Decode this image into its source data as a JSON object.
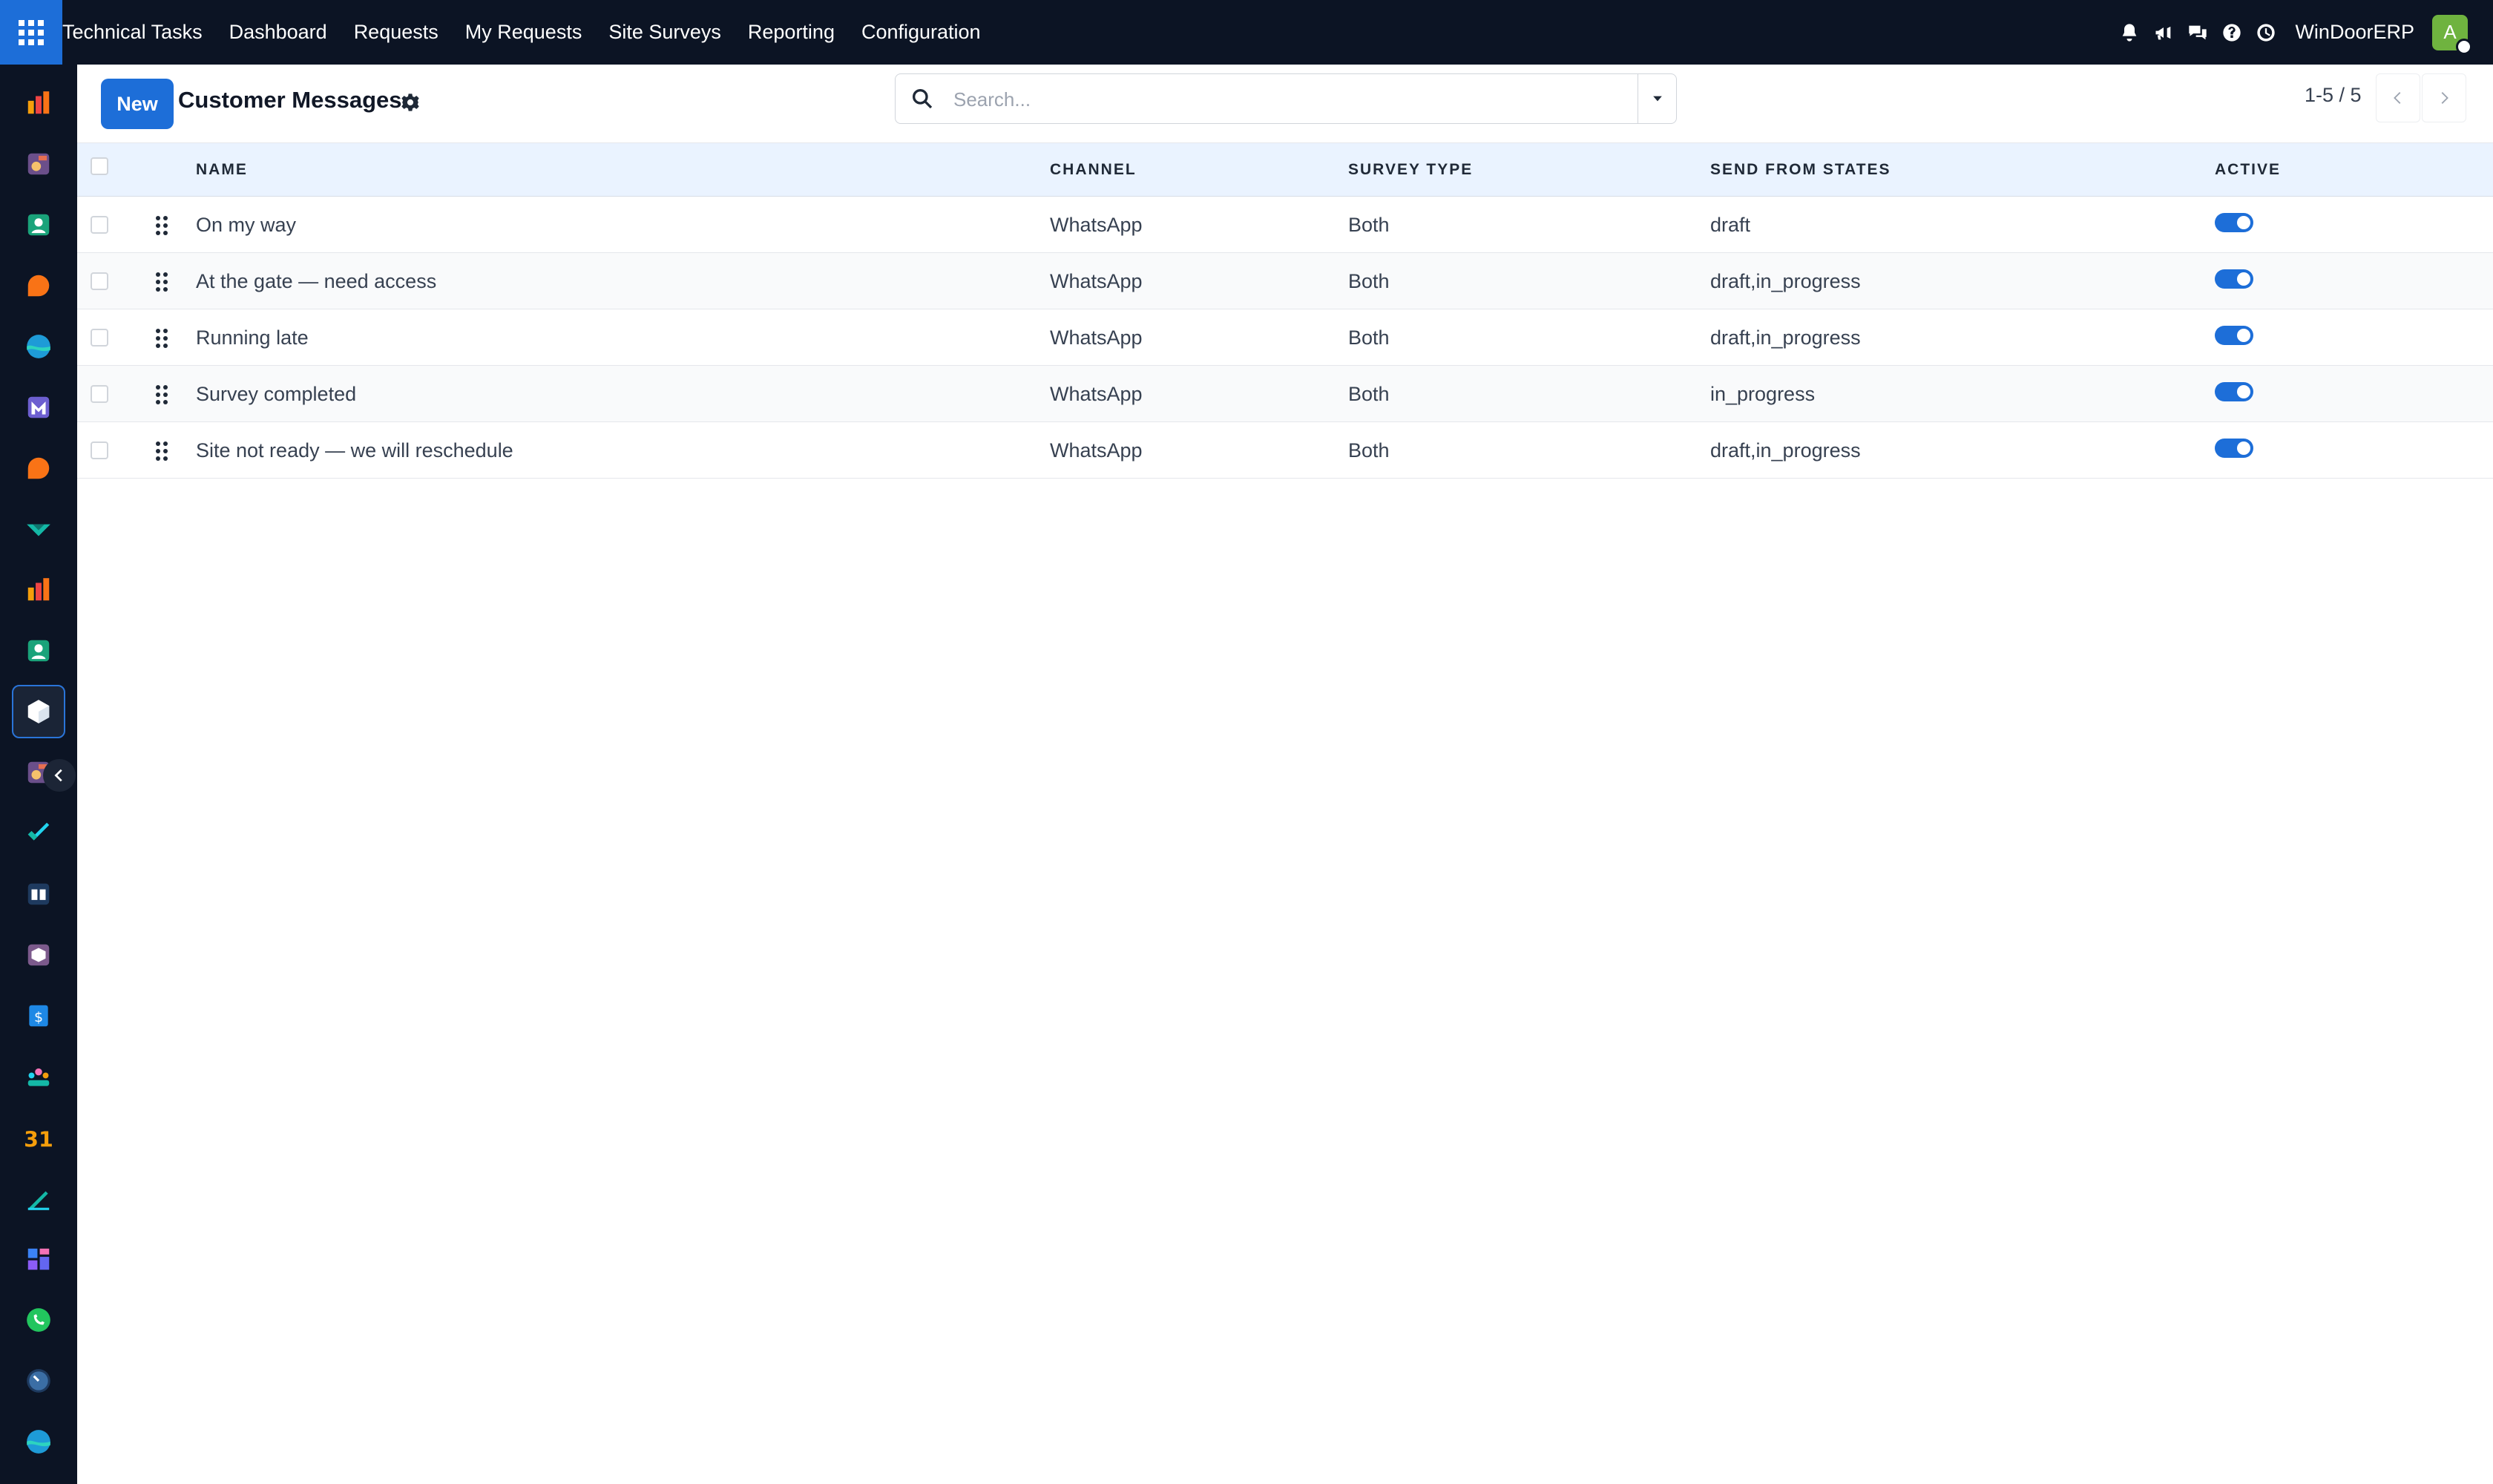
{
  "app": {
    "nav": {
      "brand": "Technical Tasks",
      "items": [
        "Dashboard",
        "Requests",
        "My Requests",
        "Site Surveys",
        "Reporting",
        "Configuration"
      ]
    },
    "company": "WinDoorERP",
    "avatar_letter": "A",
    "icons": [
      "bell-icon",
      "megaphone-icon",
      "chat-icon",
      "help-icon",
      "clock-icon"
    ]
  },
  "control_panel": {
    "new_label": "New",
    "title": "Customer Messages",
    "search_placeholder": "Search...",
    "pager_text": "1-5 / 5"
  },
  "table": {
    "columns": [
      "NAME",
      "CHANNEL",
      "SURVEY TYPE",
      "SEND FROM STATES",
      "ACTIVE"
    ],
    "rows": [
      {
        "name": "On my way",
        "channel": "WhatsApp",
        "survey_type": "Both",
        "states": "draft",
        "active": true
      },
      {
        "name": "At the gate — need access",
        "channel": "WhatsApp",
        "survey_type": "Both",
        "states": "draft,in_progress",
        "active": true
      },
      {
        "name": "Running late",
        "channel": "WhatsApp",
        "survey_type": "Both",
        "states": "draft,in_progress",
        "active": true
      },
      {
        "name": "Survey completed",
        "channel": "WhatsApp",
        "survey_type": "Both",
        "states": "in_progress",
        "active": true
      },
      {
        "name": "Site not ready — we will reschedule",
        "channel": "WhatsApp",
        "survey_type": "Both",
        "states": "draft,in_progress",
        "active": true
      }
    ]
  },
  "colors": {
    "navbar": "#0c1424",
    "primary": "#1d6ed8",
    "header_bg": "#eaf3ff"
  }
}
